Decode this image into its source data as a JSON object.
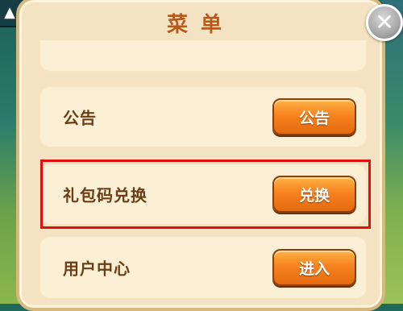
{
  "menu": {
    "title": "菜单",
    "close_symbol": "✕"
  },
  "corner": {
    "symbol": "▲"
  },
  "rows": [
    {
      "label": "公告",
      "button": "公告"
    },
    {
      "label": "礼包码兑换",
      "button": "兑换"
    },
    {
      "label": "用户中心",
      "button": "进入"
    }
  ],
  "colors": {
    "accent_orange": "#f7821e",
    "title_color": "#b8591b",
    "highlight_red": "#e01010"
  },
  "icons": [
    "gold-coin-icon",
    "close-icon",
    "home-icon"
  ]
}
